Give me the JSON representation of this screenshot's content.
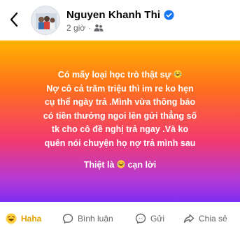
{
  "header": {
    "author_name": "Nguyen Khanh Thi",
    "timestamp": "2 giờ",
    "visibility_icon": "friends-icon",
    "verified_icon": "verified-badge-icon"
  },
  "post": {
    "background_colors": [
      "#ffb300",
      "#ff6f1e",
      "#f23a70",
      "#b43ad6",
      "#7e2df0"
    ],
    "line_1": "Có mấy loại học trò thật sự",
    "line_2": "Nợ cô  cả trăm triệu thì im re ko hẹn",
    "line_3": "cụ thể ngày trả .Mình vừa thông báo",
    "line_4": "có tiền thưởng ngoi lên gửi thẳng số",
    "line_5": "tk cho cô  đề nghị trả ngay .Và ko",
    "line_6": "quên nói chuyện họ nợ trả mình sau",
    "line_7a": "Thiệt là",
    "line_7b": "cạn lời",
    "emoji": "laughing-crying-emoji"
  },
  "actions": {
    "haha_label": "Haha",
    "comment_label": "Bình luận",
    "send_label": "Gửi",
    "share_label": "Chia sẻ",
    "haha_color": "#e5a100"
  }
}
